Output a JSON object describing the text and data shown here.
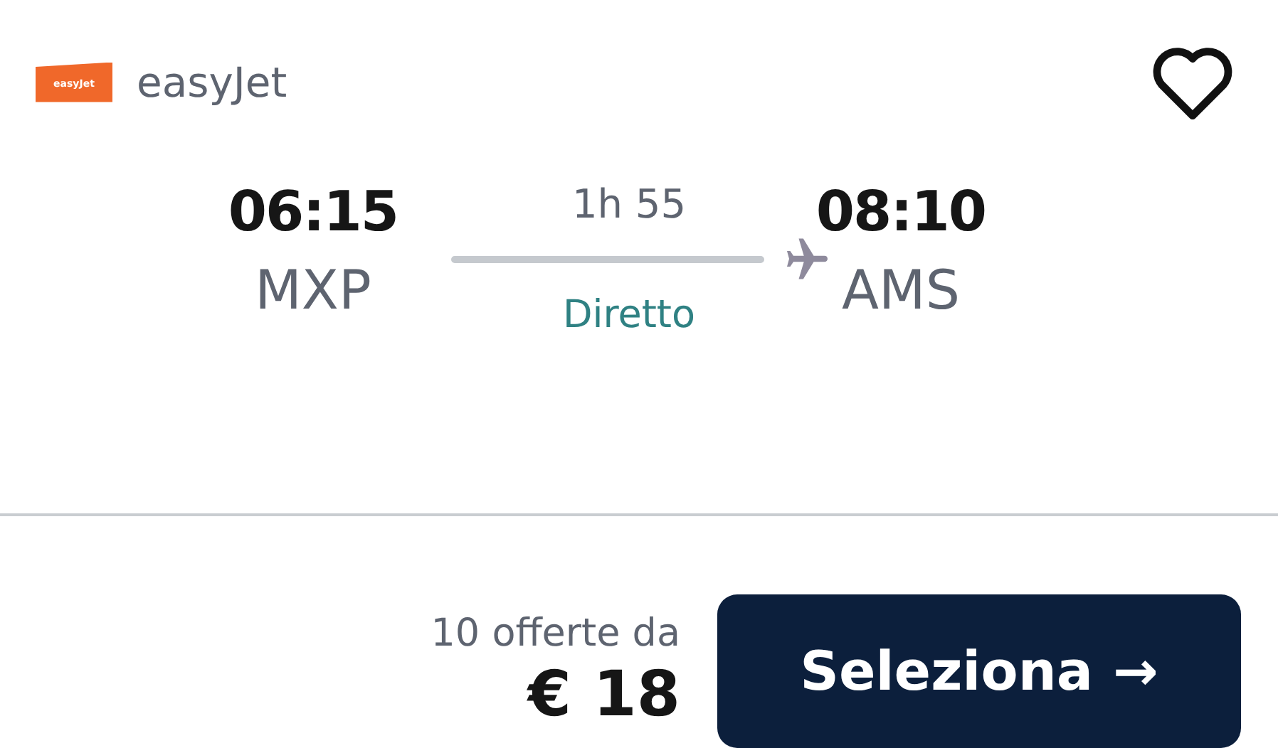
{
  "airline": {
    "logo_text": "easyJet",
    "name": "easyJet"
  },
  "favorite": {
    "selected": false
  },
  "flight": {
    "departure": {
      "time": "06:15",
      "airport": "MXP"
    },
    "duration": "1h 55",
    "stops": "Diretto",
    "arrival": {
      "time": "08:10",
      "airport": "AMS"
    }
  },
  "offer": {
    "count_text": "10 offerte da",
    "price": "€ 18"
  },
  "select_button": {
    "label": "Seleziona",
    "icon": "→"
  }
}
